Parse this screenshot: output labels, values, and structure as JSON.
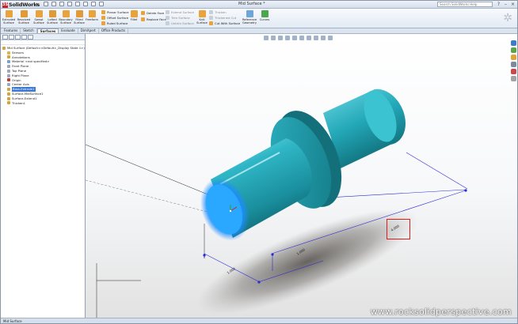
{
  "app": {
    "logo_text": "SolidWorks",
    "doc_title": "Mid Surface *",
    "search_placeholder": "Search SolidWorks Help"
  },
  "ribbon": {
    "large_buttons": [
      {
        "label": "Extruded Surface",
        "icon": "extruded-surface-icon",
        "color": "#e8a33c"
      },
      {
        "label": "Revolved Surface",
        "icon": "revolved-surface-icon",
        "color": "#e8a33c"
      },
      {
        "label": "Swept Surface",
        "icon": "swept-surface-icon",
        "color": "#e8a33c"
      },
      {
        "label": "Lofted Surface",
        "icon": "lofted-surface-icon",
        "color": "#e8a33c"
      },
      {
        "label": "Boundary Surface",
        "icon": "boundary-surface-icon",
        "color": "#e8a33c"
      },
      {
        "label": "Filled Surface",
        "icon": "filled-surface-icon",
        "color": "#e8a33c"
      },
      {
        "label": "Freeform",
        "icon": "freeform-icon",
        "color": "#e8a33c"
      }
    ],
    "col1": [
      "Planar Surface",
      "Offset Surface",
      "Ruled Surface"
    ],
    "fillet_label": "Fillet",
    "col2": [
      "Delete Face",
      "Replace Face"
    ],
    "col3": [
      "Extend Surface",
      "Trim Surface",
      "Untrim Surface"
    ],
    "knit_label": "Knit Surface",
    "col4": [
      "Thicken",
      "Thickened Cut",
      "Cut With Surface"
    ],
    "ref_geometry_label": "Reference Geometry",
    "curves_label": "Curves"
  },
  "tabs": [
    "Features",
    "Sketch",
    "Surfaces",
    "Evaluate",
    "DimXpert",
    "Office Products"
  ],
  "active_tab": "Surfaces",
  "tree": [
    {
      "label": "Mid Surface  (Default<<Default>_Display State 1>)",
      "indent": 0,
      "icon": "part-icon",
      "color": "#d8a33c"
    },
    {
      "label": "Sensors",
      "indent": 1,
      "icon": "sensors-icon",
      "color": "#e0b24a"
    },
    {
      "label": "Annotations",
      "indent": 1,
      "icon": "annotations-icon",
      "color": "#d8a33c"
    },
    {
      "label": "Material <not specified>",
      "indent": 1,
      "icon": "material-icon",
      "color": "#7aa0d0"
    },
    {
      "label": "Front Plane",
      "indent": 1,
      "icon": "plane-icon",
      "color": "#9aa8bb"
    },
    {
      "label": "Top Plane",
      "indent": 1,
      "icon": "plane-icon",
      "color": "#9aa8bb"
    },
    {
      "label": "Right Plane",
      "indent": 1,
      "icon": "plane-icon",
      "color": "#9aa8bb"
    },
    {
      "label": "Origin",
      "indent": 1,
      "icon": "origin-icon",
      "color": "#c23a3a"
    },
    {
      "label": "Center Axis",
      "indent": 1,
      "icon": "axis-icon",
      "color": "#9aa8bb"
    },
    {
      "label": "Boss-Extrude1",
      "indent": 1,
      "icon": "extrude-icon",
      "color": "#d8a33c",
      "selected": true
    },
    {
      "label": "Surface-MidSurface1",
      "indent": 1,
      "icon": "surface-icon",
      "color": "#d8a33c"
    },
    {
      "label": "Surface-Extend1",
      "indent": 1,
      "icon": "surface-icon",
      "color": "#d8a33c"
    },
    {
      "label": "Thicken1",
      "indent": 1,
      "icon": "thicken-icon",
      "color": "#d8a33c"
    }
  ],
  "viewport": {
    "dim_highlighted": "4.000",
    "dim_2": "1.000",
    "dim_3": "1.000",
    "watermark": "www.rocksolidperspective.com",
    "part_color": "#2fb6c6",
    "glow_color": "#1d8cff"
  },
  "status": {
    "text": "Mid Surface"
  }
}
